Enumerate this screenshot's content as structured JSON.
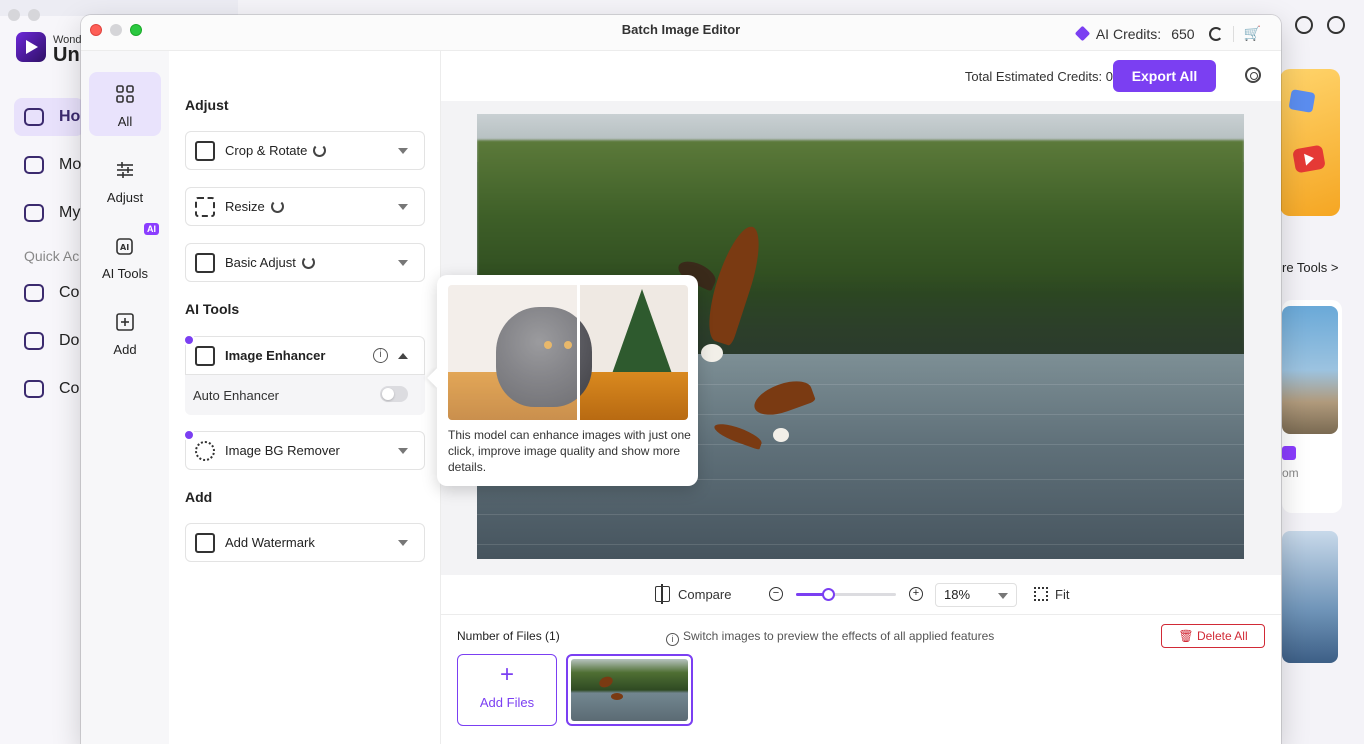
{
  "background_app": {
    "brand_small": "Wond",
    "brand_big": "Uni",
    "nav": [
      {
        "label": "Ho",
        "active": true
      },
      {
        "label": "Mo",
        "active": false
      },
      {
        "label": "My",
        "active": false
      }
    ],
    "quick_access_label": "Quick Ac",
    "quick_items": [
      "Co",
      "Do",
      "Co"
    ],
    "more_tools_label": "re Tools >",
    "card_suffix": "om",
    "card_ai_tag": "AI"
  },
  "window": {
    "title": "Batch Image Editor",
    "ai_credits_label": "AI Credits:",
    "ai_credits_value": "650"
  },
  "rail": {
    "items": [
      {
        "label": "All",
        "icon": "grid-icon",
        "active": true
      },
      {
        "label": "Adjust",
        "icon": "sliders-icon",
        "active": false
      },
      {
        "label": "AI Tools",
        "icon": "ai-icon",
        "active": false,
        "tag": "AI"
      },
      {
        "label": "Add",
        "icon": "plus-square-icon",
        "active": false
      }
    ]
  },
  "panel": {
    "adjust_title": "Adjust",
    "ai_tools_title": "AI Tools",
    "add_title": "Add",
    "tools": {
      "crop_rotate": "Crop & Rotate",
      "resize": "Resize",
      "basic_adjust": "Basic Adjust",
      "image_enhancer": "Image Enhancer",
      "auto_enhancer": "Auto Enhancer",
      "auto_enhancer_on": false,
      "bg_remover": "Image BG Remover",
      "add_watermark": "Add Watermark"
    }
  },
  "tooltip": {
    "text": "This model can enhance images with just one click, improve image quality and show more details."
  },
  "toolbar": {
    "total_credits_label": "Total Estimated Credits:",
    "total_credits_value": "0",
    "export_label": "Export All"
  },
  "zoom": {
    "compare_label": "Compare",
    "zoom_value": "18%",
    "zoom_level": 0.18,
    "fit_label": "Fit"
  },
  "files": {
    "count_label": "Number of Files (1)",
    "hint": "Switch images to preview the effects of all applied features",
    "delete_label": "Delete All",
    "add_files_label": "Add Files"
  },
  "colors": {
    "accent": "#7b3ff2",
    "danger": "#d12a36"
  }
}
